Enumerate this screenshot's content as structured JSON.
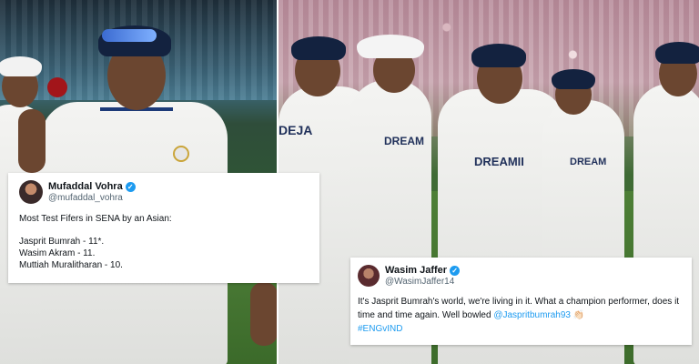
{
  "tweets": [
    {
      "author": "Mufaddal Vohra",
      "handle": "@mufaddal_vohra",
      "headline": "Most Test Fifers in SENA by an Asian:",
      "lines": [
        "Jasprit Bumrah - 11*.",
        "Wasim Akram - 11.",
        "Muttiah Muralitharan - 10."
      ]
    },
    {
      "author": "Wasim Jaffer",
      "handle": "@WasimJaffer14",
      "text": "It's Jasprit Bumrah's world, we're living in it. What a champion performer, does it time and time again. Well bowled ",
      "mention": "@Jaspritbumrah93",
      "emoji": "👏🏻",
      "hashtag": "#ENGvIND"
    }
  ],
  "jersey_texts": [
    "DREAMII",
    "DREAM",
    "DEJA",
    "DREAM"
  ],
  "colors": {
    "verified": "#1d9bf0",
    "link": "#1d9bf0",
    "jersey_trim": "#1c3a78"
  },
  "icons": [
    "verified-badge-icon"
  ]
}
